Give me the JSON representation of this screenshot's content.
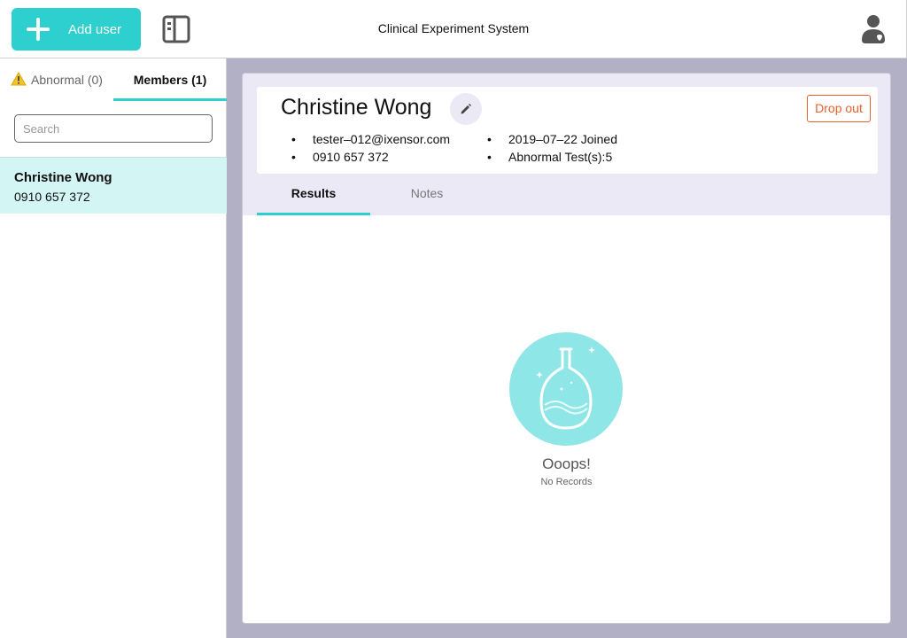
{
  "header": {
    "add_user_label": "Add user",
    "app_title": "Clinical Experiment System",
    "add_icon": "plus-icon",
    "sidebar_icon": "sidebar-toggle-icon",
    "profile_icon": "user-account-icon"
  },
  "left_panel": {
    "tabs": [
      {
        "label": "Abnormal (0)",
        "icon": "warning-icon",
        "active": false
      },
      {
        "label": "Members (1)",
        "active": true
      }
    ],
    "search_placeholder": "Search",
    "members": [
      {
        "name": "Christine Wong",
        "phone": "0910 657 372",
        "selected": true
      }
    ]
  },
  "detail": {
    "name": "Christine Wong",
    "edit_icon": "pencil-icon",
    "drop_out_label": "Drop out",
    "email": "tester–012@ixensor.com",
    "phone": "0910 657 372",
    "joined": "2019–07–22 Joined",
    "abnormal_tests": "Abnormal Test(s):5",
    "tabs": [
      {
        "label": "Results",
        "active": true
      },
      {
        "label": "Notes",
        "active": false
      }
    ]
  },
  "empty_state": {
    "icon": "flask-icon",
    "title": "Ooops!",
    "subtitle": "No Records"
  },
  "colors": {
    "accent": "#2ecfcf",
    "danger": "#e8602a",
    "main_bg": "#b1b0c5",
    "selected_row": "#d3f5f3",
    "lavender": "#ebe9f6"
  }
}
